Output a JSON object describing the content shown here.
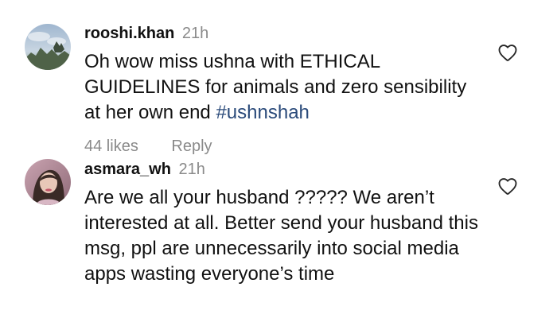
{
  "comments": [
    {
      "avatar": "avatar-photo-sky",
      "username": "rooshi.khan",
      "time": "21h",
      "text": "Oh wow miss ushna with ETHICAL GUIDELINES for animals and zero sensibility at her own end ",
      "hashtag": "#ushnshah",
      "likes": "44 likes",
      "reply": "Reply",
      "like_icon": "heart-outline-icon"
    },
    {
      "avatar": "avatar-photo-woman",
      "username": "asmara_wh",
      "time": "21h",
      "text": "Are we all your husband ????? We aren’t interested at all. Better send your husband this msg, ppl are unnecessarily into social media apps wasting everyone’s time",
      "like_icon": "heart-outline-icon"
    }
  ],
  "colors": {
    "text": "#111111",
    "muted": "#8a8a8a",
    "hashtag": "#2a4a7a",
    "background": "#ffffff"
  }
}
